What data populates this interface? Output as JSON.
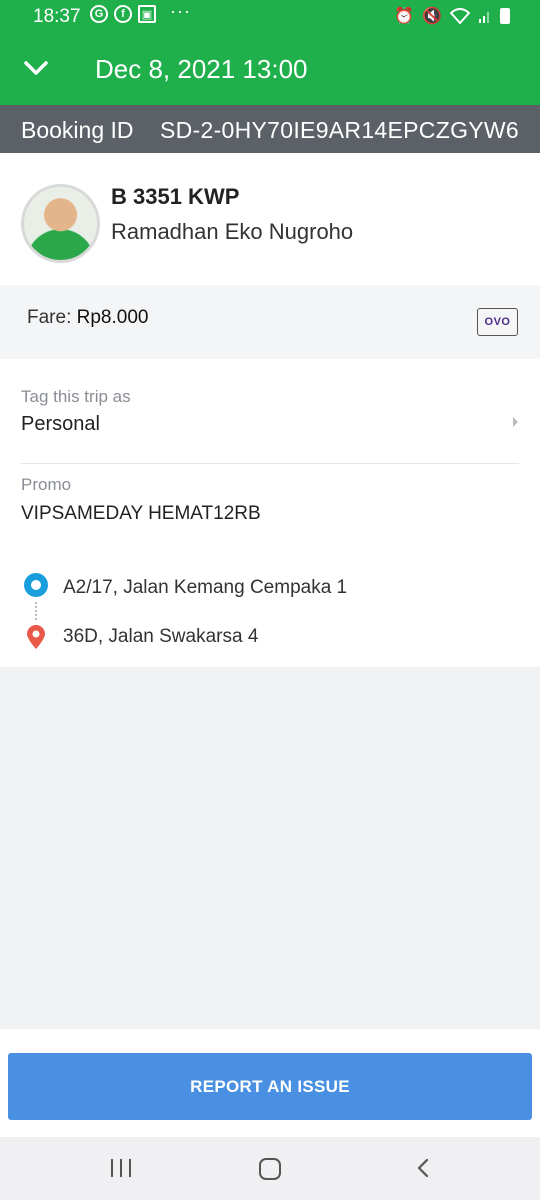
{
  "status_bar": {
    "time": "18:37",
    "notification_icons": [
      "G",
      "f",
      "▣"
    ],
    "more": "···"
  },
  "header": {
    "datetime": "Dec 8, 2021 13:00"
  },
  "booking": {
    "label": "Booking ID",
    "id": "SD-2-0HY70IE9AR14EPCZGYW6"
  },
  "driver": {
    "plate": "B 3351 KWP",
    "name": "Ramadhan Eko Nugroho"
  },
  "fare": {
    "label": "Fare:",
    "amount": "Rp8.000",
    "payment_badge": "OVO"
  },
  "tag": {
    "title": "Tag this trip as",
    "value": "Personal"
  },
  "promo": {
    "title": "Promo",
    "code": "VIPSAMEDAY HEMAT12RB"
  },
  "route": {
    "pickup": "A2/17,  Jalan Kemang Cempaka 1",
    "dropoff": "36D,  Jalan Swakarsa 4"
  },
  "actions": {
    "report_label": "REPORT AN ISSUE"
  },
  "colors": {
    "brand_green": "#1fb04c",
    "booking_bar": "#5c6168",
    "pickup_blue": "#1a9edb",
    "drop_red": "#e8594a",
    "button_blue": "#4a90e2"
  }
}
